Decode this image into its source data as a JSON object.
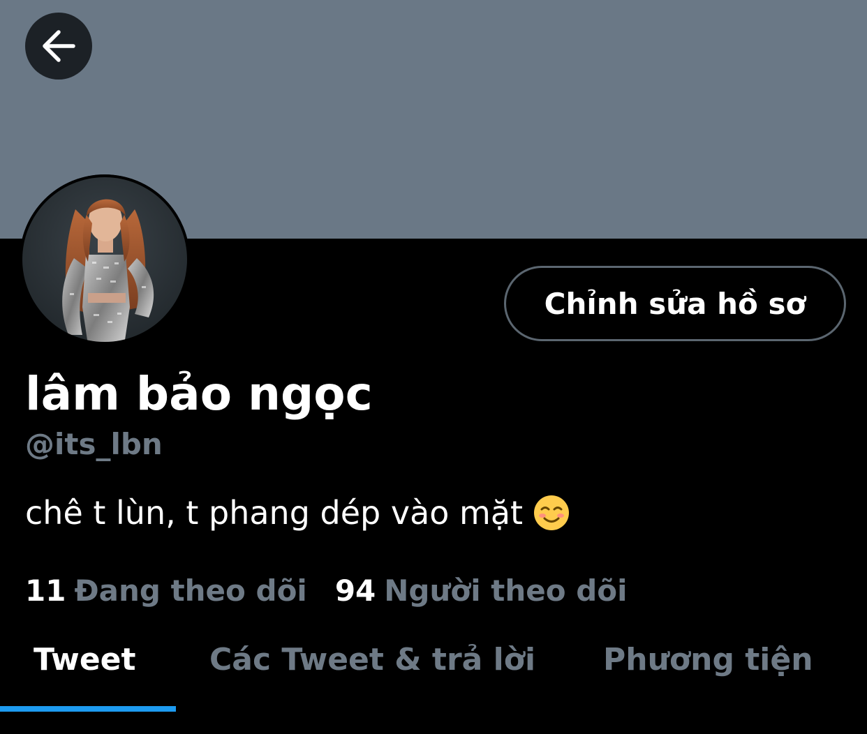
{
  "profile": {
    "display_name": "lâm bảo ngọc",
    "handle": "@its_lbn",
    "bio": "chê t lùn, t phang dép vào mặt",
    "bio_emoji": "☺️"
  },
  "header": {
    "back_icon": "arrow-left-icon",
    "edit_profile_label": "Chỉnh sửa hồ sơ"
  },
  "stats": {
    "following_count": "11",
    "following_label": "Đang theo dõi",
    "followers_count": "94",
    "followers_label": "Người theo dõi"
  },
  "tabs": [
    {
      "label": "Tweet",
      "active": true
    },
    {
      "label": "Các Tweet & trả lời",
      "active": false
    },
    {
      "label": "Phương tiện",
      "active": false
    }
  ],
  "colors": {
    "banner": "#6a7886",
    "background": "#000000",
    "accent": "#1d9bf0",
    "secondary_text": "#6e7a86"
  }
}
